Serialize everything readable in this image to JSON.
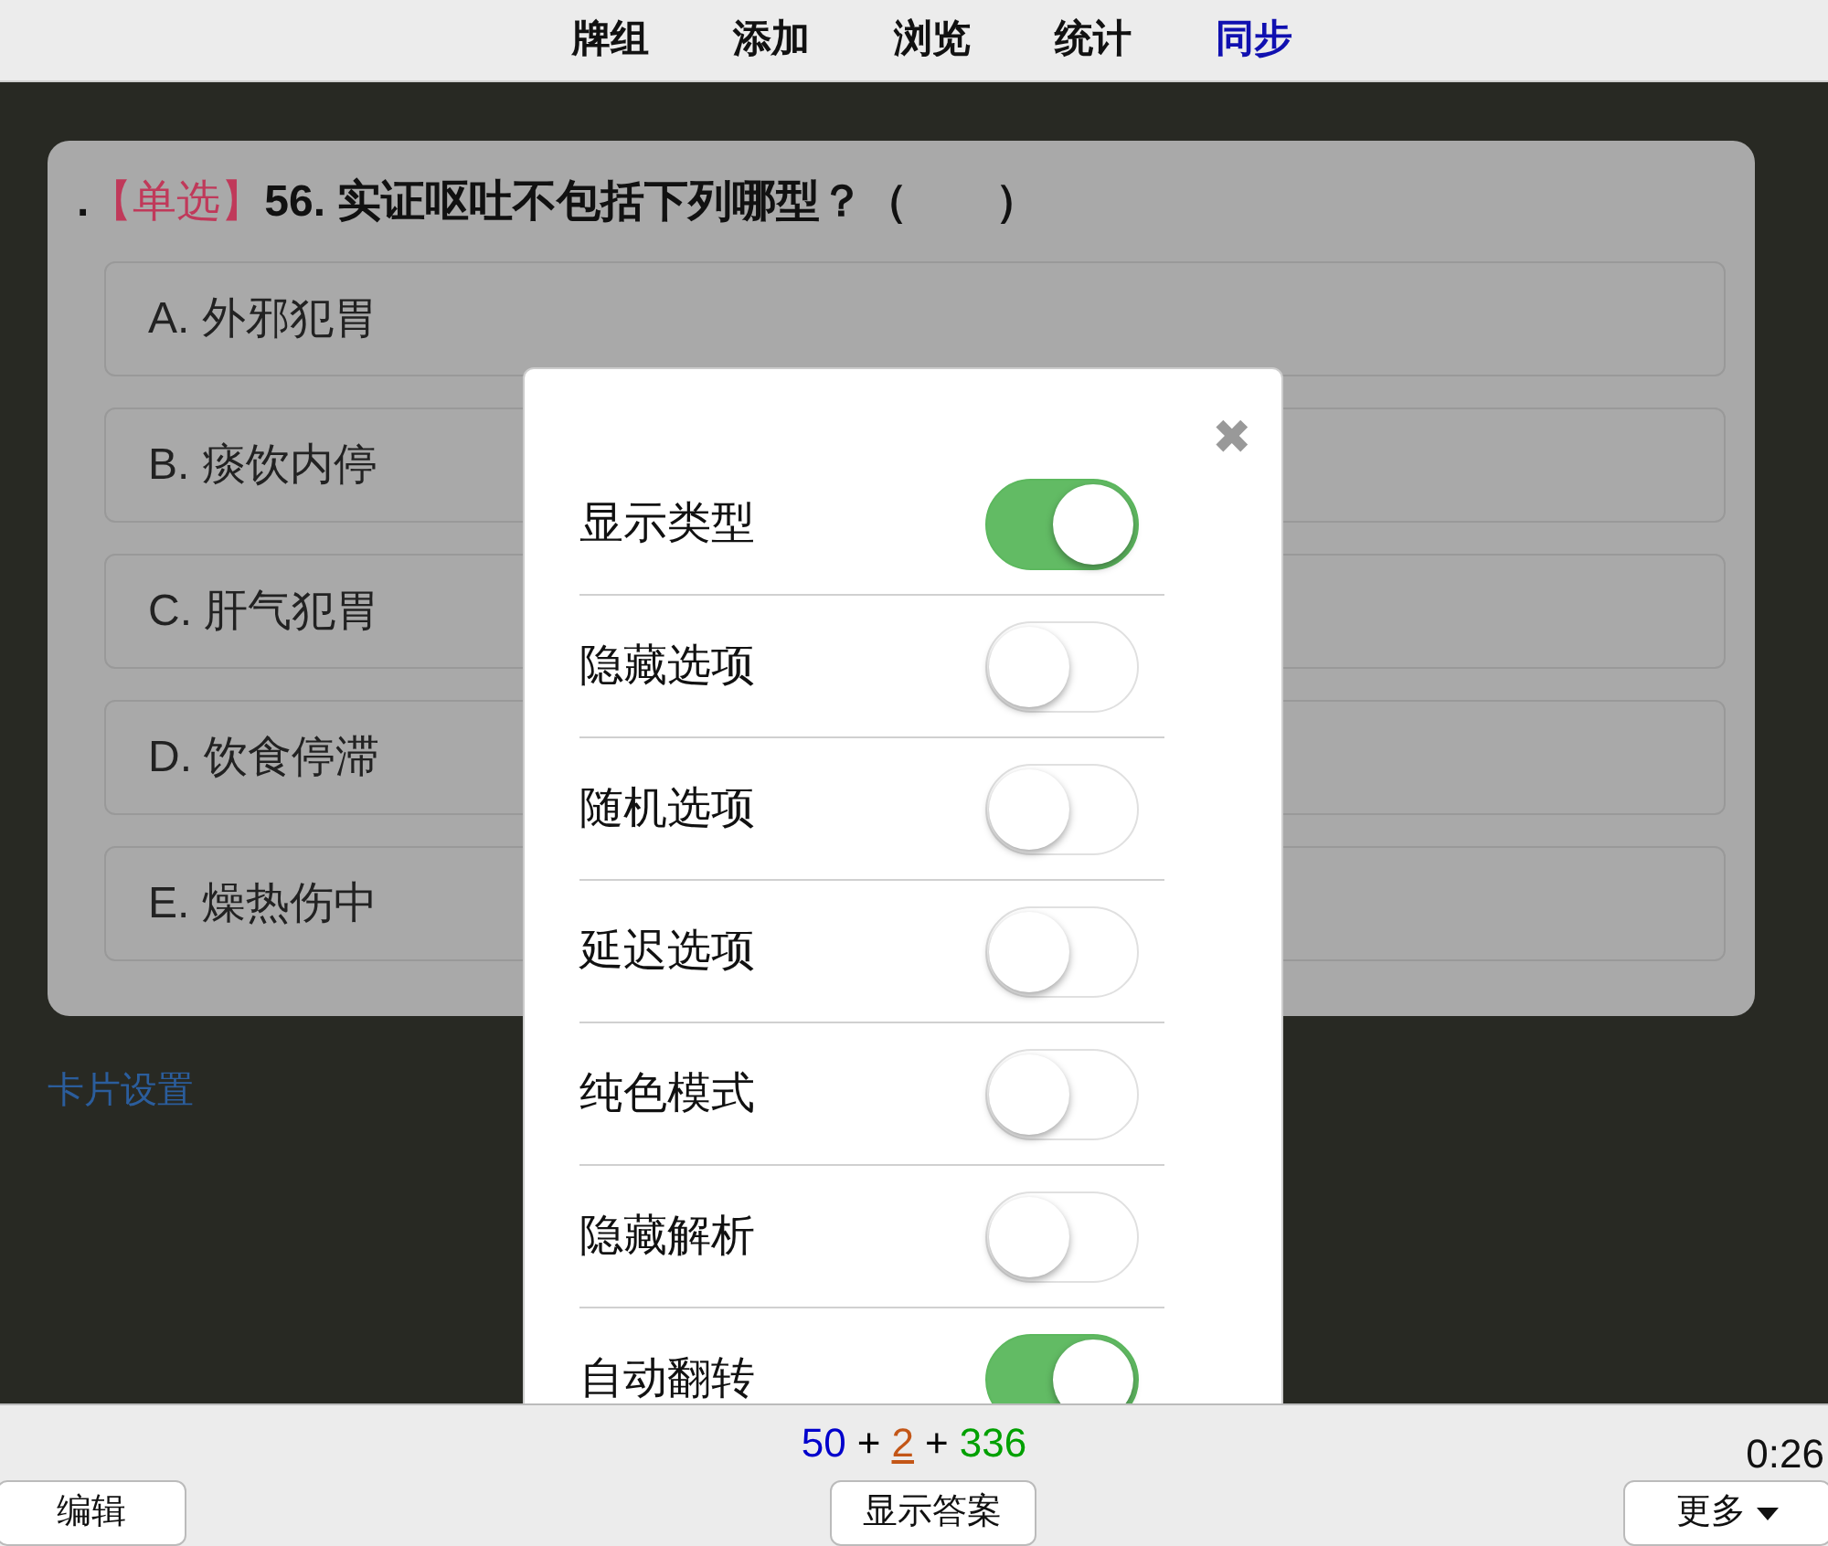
{
  "nav": [
    {
      "label": "牌组",
      "selected": false
    },
    {
      "label": "添加",
      "selected": false
    },
    {
      "label": "浏览",
      "selected": false
    },
    {
      "label": "统计",
      "selected": false
    },
    {
      "label": "同步",
      "selected": true
    }
  ],
  "question": {
    "prefix": ".",
    "type": "【单选】",
    "text": "56. 实证呕吐不包括下列哪型？（　　）"
  },
  "options": [
    "A. 外邪犯胃",
    "B. 痰饮内停",
    "C. 肝气犯胃",
    "D. 饮食停滞",
    "E. 燥热伤中"
  ],
  "card_settings_link": "卡片设置",
  "settings_dialog": {
    "close": "✖",
    "toggles": [
      {
        "label": "显示类型",
        "on": true
      },
      {
        "label": "隐藏选项",
        "on": false
      },
      {
        "label": "随机选项",
        "on": false
      },
      {
        "label": "延迟选项",
        "on": false
      },
      {
        "label": "纯色模式",
        "on": false
      },
      {
        "label": "隐藏解析",
        "on": false
      },
      {
        "label": "自动翻转",
        "on": true
      }
    ]
  },
  "counts": [
    {
      "text": "50",
      "color": "#0000cc",
      "underlined": false
    },
    {
      "text": "+",
      "color": "#000000",
      "underlined": false
    },
    {
      "text": "2",
      "color": "#c35617",
      "underlined": true
    },
    {
      "text": "+",
      "color": "#000000",
      "underlined": false
    },
    {
      "text": "336",
      "color": "#00a000",
      "underlined": false
    }
  ],
  "timer": "0:26",
  "buttons": {
    "edit": "编辑",
    "show_answer": "显示答案",
    "more": "更多"
  }
}
